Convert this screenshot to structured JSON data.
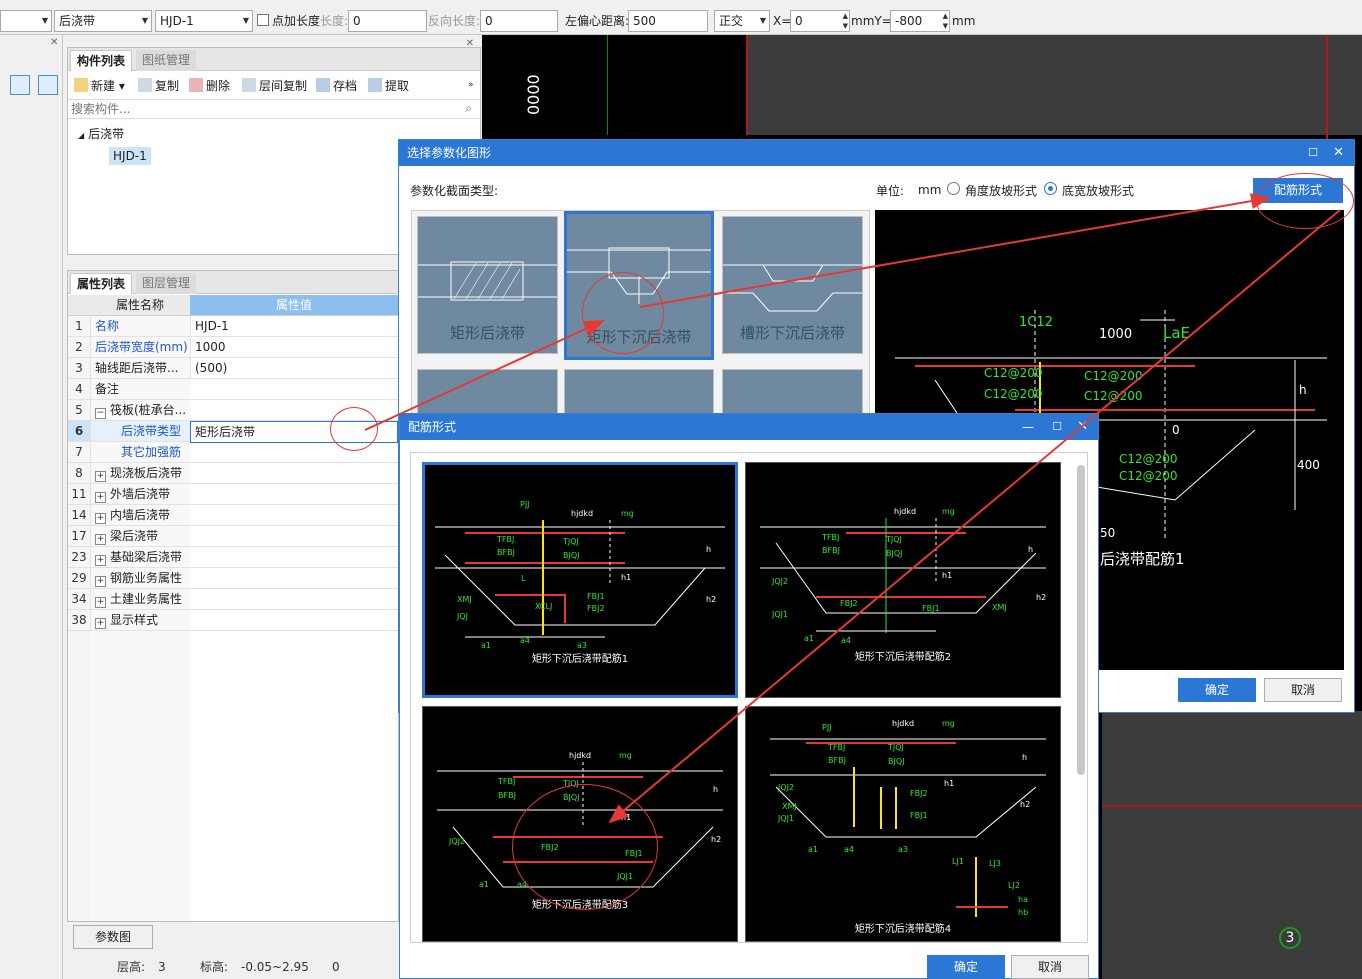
{
  "toolbar": {
    "combo1": "",
    "combo2": "后浇带",
    "combo3": "HJD-1",
    "add_length_label": "点加长度",
    "length_label": "长度:",
    "length_value": "0",
    "reverse_length_label": "反向长度:",
    "reverse_length_value": "0",
    "left_offset_label": "左偏心距离:",
    "left_offset_value": "500",
    "mode": "正交",
    "x_label": "X=",
    "x_value": "0",
    "mm_y_label": "mmY=",
    "y_value": "-800",
    "unit": "mm"
  },
  "component_panel": {
    "tabs": [
      "构件列表",
      "图纸管理"
    ],
    "actions": [
      "新建",
      "复制",
      "删除",
      "层间复制",
      "存档",
      "提取"
    ],
    "search_placeholder": "搜索构件...",
    "tree_root": "后浇带",
    "tree_child": "HJD-1"
  },
  "property_panel": {
    "tabs": [
      "属性列表",
      "图层管理"
    ],
    "col_name": "属性名称",
    "col_value": "属性值",
    "rows": [
      {
        "num": "1",
        "name": "名称",
        "value": "HJD-1"
      },
      {
        "num": "2",
        "name": "后浇带宽度(mm)",
        "value": "1000"
      },
      {
        "num": "3",
        "name": "轴线距后浇带...",
        "value": "(500)"
      },
      {
        "num": "4",
        "name": "备注",
        "value": ""
      },
      {
        "num": "5",
        "name": "筏板(桩承台...",
        "value": ""
      },
      {
        "num": "6",
        "name": "后浇带类型",
        "value": "矩形后浇带"
      },
      {
        "num": "7",
        "name": "其它加强筋",
        "value": ""
      },
      {
        "num": "8",
        "name": "现浇板后浇带",
        "value": ""
      },
      {
        "num": "11",
        "name": "外墙后浇带",
        "value": ""
      },
      {
        "num": "14",
        "name": "内墙后浇带",
        "value": ""
      },
      {
        "num": "17",
        "name": "梁后浇带",
        "value": ""
      },
      {
        "num": "23",
        "name": "基础梁后浇带",
        "value": ""
      },
      {
        "num": "29",
        "name": "钢筋业务属性",
        "value": ""
      },
      {
        "num": "34",
        "name": "土建业务属性",
        "value": ""
      },
      {
        "num": "38",
        "name": "显示样式",
        "value": ""
      }
    ],
    "param_button": "参数图"
  },
  "status": {
    "floor_label": "层高:",
    "floor_value": "3",
    "elev_label": "标高:",
    "elev_value": "-0.05~2.95",
    "extra": "0"
  },
  "cad": {
    "vertical_text": "0000",
    "badge": "3"
  },
  "dialog_param": {
    "title": "选择参数化图形",
    "type_label": "参数化截面类型:",
    "unit_label": "单位:",
    "unit_value": "mm",
    "radio1": "角度放坡形式",
    "radio2": "底宽放坡形式",
    "rebar_button": "配筋形式",
    "shapes": [
      "矩形后浇带",
      "矩形下沉后浇带",
      "槽形下沉后浇带"
    ],
    "preview": {
      "t1": "1C12",
      "t2": "1000",
      "t3": "LaE",
      "t4": "C12@200",
      "t5": "C12@200",
      "t6": "C12@200",
      "t7": "C12@200",
      "t8": "C12@200",
      "t9": "C12@200",
      "t10": "h",
      "t11": "400",
      "t12": "0",
      "t13": "50",
      "caption": "后浇带配筋1"
    },
    "ok": "确定",
    "cancel": "取消"
  },
  "dialog_rebar": {
    "title": "配筋形式",
    "items": [
      {
        "caption": "矩形下沉后浇带配筋1",
        "labels": [
          "PJJ",
          "hjdkd",
          "mg",
          "TFBJ",
          "BFBJ",
          "TJQJ",
          "BJQJ",
          "h",
          "h1",
          "h2",
          "XMJ",
          "JQJ",
          "XCLJ",
          "FBJ1",
          "FBJ2",
          "a1",
          "a4",
          "a3",
          "L"
        ]
      },
      {
        "caption": "矩形下沉后浇带配筋2",
        "labels": [
          "hjdkd",
          "mg",
          "TFBJ",
          "BFBJ",
          "TJQJ",
          "BJQJ",
          "h",
          "h1",
          "h2",
          "JQJ2",
          "JQJ1",
          "FBJ2",
          "FBJ1",
          "XMJ",
          "a1",
          "a4"
        ]
      },
      {
        "caption": "矩形下沉后浇带配筋3",
        "labels": [
          "hjdkd",
          "mg",
          "TFBJ",
          "BFBJ",
          "TJQJ",
          "BJQJ",
          "h",
          "h1",
          "h2",
          "JQJ2",
          "FBJ2",
          "FBJ1",
          "JQJ1",
          "a1",
          "a4"
        ]
      },
      {
        "caption": "矩形下沉后浇带配筋4",
        "labels": [
          "PJJ",
          "hjdkd",
          "mg",
          "TFBJ",
          "BFBJ",
          "TJQJ",
          "BJQJ",
          "h",
          "h1",
          "h2",
          "JQJ2",
          "XMJ",
          "JQJ1",
          "FBJ2",
          "FBJ1",
          "a1",
          "a4",
          "a3",
          "LJ1",
          "LJ3",
          "LJ2",
          "ha",
          "hb"
        ]
      }
    ],
    "ok": "确定",
    "cancel": "取消"
  },
  "colors": {
    "accent": "#2b77d3",
    "annotation": "#e53935"
  }
}
